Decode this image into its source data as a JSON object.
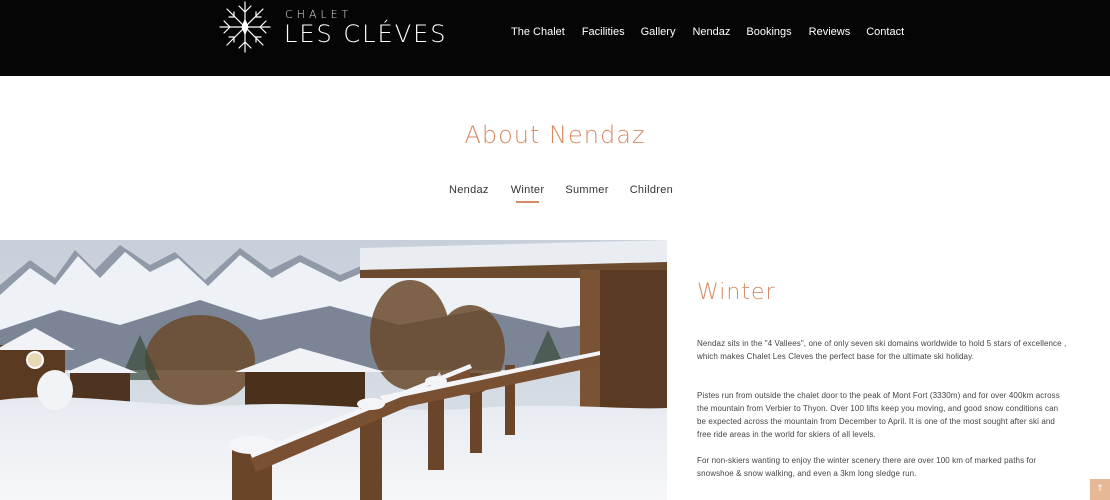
{
  "brand": {
    "small": "CHALET",
    "big": "LES CLÉVES",
    "icon": "snowflake-icon"
  },
  "nav": {
    "items": [
      {
        "label": "The Chalet"
      },
      {
        "label": "Facilities"
      },
      {
        "label": "Gallery"
      },
      {
        "label": "Nendaz"
      },
      {
        "label": "Bookings"
      },
      {
        "label": "Reviews"
      },
      {
        "label": "Contact"
      }
    ]
  },
  "section": {
    "title": "About Nendaz",
    "tabs": [
      {
        "label": "Nendaz"
      },
      {
        "label": "Winter",
        "active": true
      },
      {
        "label": "Summer"
      },
      {
        "label": "Children"
      }
    ]
  },
  "content": {
    "title": "Winter",
    "paragraphs": [
      "Nendaz sits in the \"4 Vallees\", one of only seven ski domains worldwide to hold 5 stars of excellence , which makes Chalet Les Cleves the perfect base for the ultimate ski holiday.",
      "Pistes run from outside the chalet door to the peak of Mont Fort (3330m) and for over 400km across the mountain from Verbier to Thyon. Over 100 lifts keep you moving, and good snow conditions can be expected across the mountain from December to April. It is one of the most sought after ski and free ride areas in the world for skiers of all levels.",
      "For non-skiers wanting to enjoy the winter scenery there are over 100 km of marked paths for snowshoe & snow walking, and even a 3km long sledge run."
    ]
  },
  "scroll_top": {
    "label": "↑",
    "icon": "arrow-up-icon"
  },
  "colors": {
    "accent": "#d58a63",
    "header_bg": "#050505",
    "scroll_top_bg": "#e7b896"
  }
}
